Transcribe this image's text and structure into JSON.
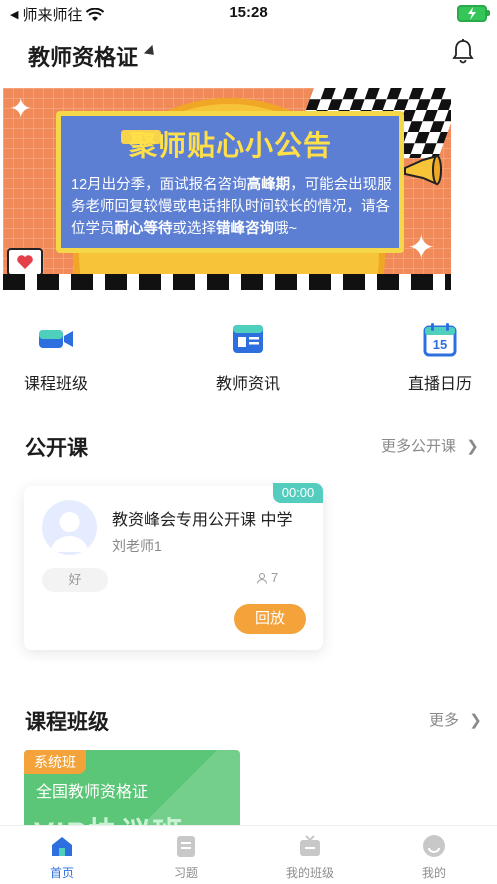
{
  "status_bar": {
    "carrier": "师来师往",
    "time": "15:28"
  },
  "header": {
    "title": "教师资格证"
  },
  "banner": {
    "title": "聚师贴心小公告",
    "body_1": "12月出分季，面试报名咨询",
    "body_2": "高峰期",
    "body_3": "，可能会出现服务老师回复较慢或电话排队时间较长的情况，请各位学员",
    "body_4": "耐心等待",
    "body_5": "或选择",
    "body_6": "错峰咨询",
    "body_7": "哦~"
  },
  "quick_nav": [
    {
      "label": "课程班级",
      "icon": "video-camera-icon"
    },
    {
      "label": "教师资讯",
      "icon": "news-icon"
    },
    {
      "label": "直播日历",
      "icon": "calendar-icon",
      "day": "15"
    }
  ],
  "open_class": {
    "title": "公开课",
    "more": "更多公开课",
    "card": {
      "time": "00:00",
      "title": "教资峰会专用公开课 中学",
      "teacher": "刘老师1",
      "rating": "好",
      "viewers": "7",
      "button": "回放"
    }
  },
  "classes": {
    "title": "课程班级",
    "more": "更多",
    "card": {
      "tag": "系统班",
      "name": "全国教师资格证",
      "big": "VIP协议班"
    }
  },
  "tabs": [
    {
      "label": "首页",
      "icon": "home-icon",
      "active": true
    },
    {
      "label": "习题",
      "icon": "exercise-icon",
      "active": false
    },
    {
      "label": "我的班级",
      "icon": "tv-icon",
      "active": false
    },
    {
      "label": "我的",
      "icon": "profile-icon",
      "active": false
    }
  ],
  "colors": {
    "accent": "#2e6fe0",
    "orange": "#f4a23a",
    "teal": "#55cdbe",
    "green": "#5cc678"
  }
}
